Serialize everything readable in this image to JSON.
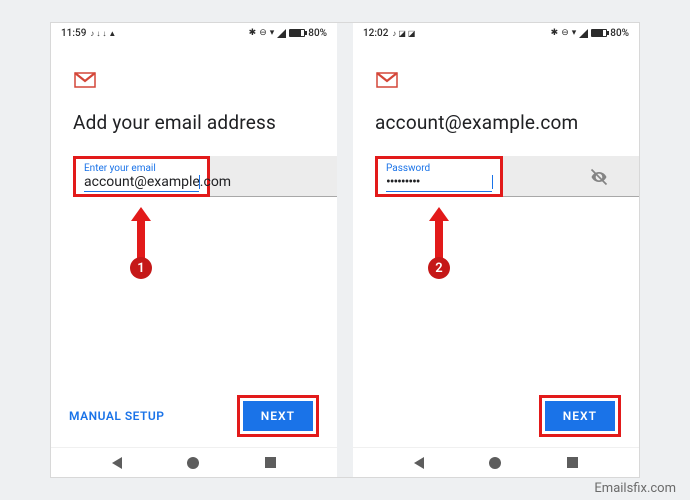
{
  "screens": {
    "left": {
      "statusbar": {
        "time": "11:59",
        "battery": "80%",
        "left_icons": "♪ ↓ ↓ ▲"
      },
      "title": "Add your email address",
      "field": {
        "label": "Enter your email",
        "value": "account@example.com"
      },
      "footer": {
        "manual_setup": "MANUAL SETUP",
        "next": "NEXT"
      },
      "badge": "1"
    },
    "right": {
      "statusbar": {
        "time": "12:02",
        "battery": "80%"
      },
      "title": "account@example.com",
      "field": {
        "label": "Password",
        "value": "•••••••••"
      },
      "footer": {
        "next": "NEXT"
      },
      "badge": "2"
    }
  },
  "watermark": "Emailsfix.com"
}
